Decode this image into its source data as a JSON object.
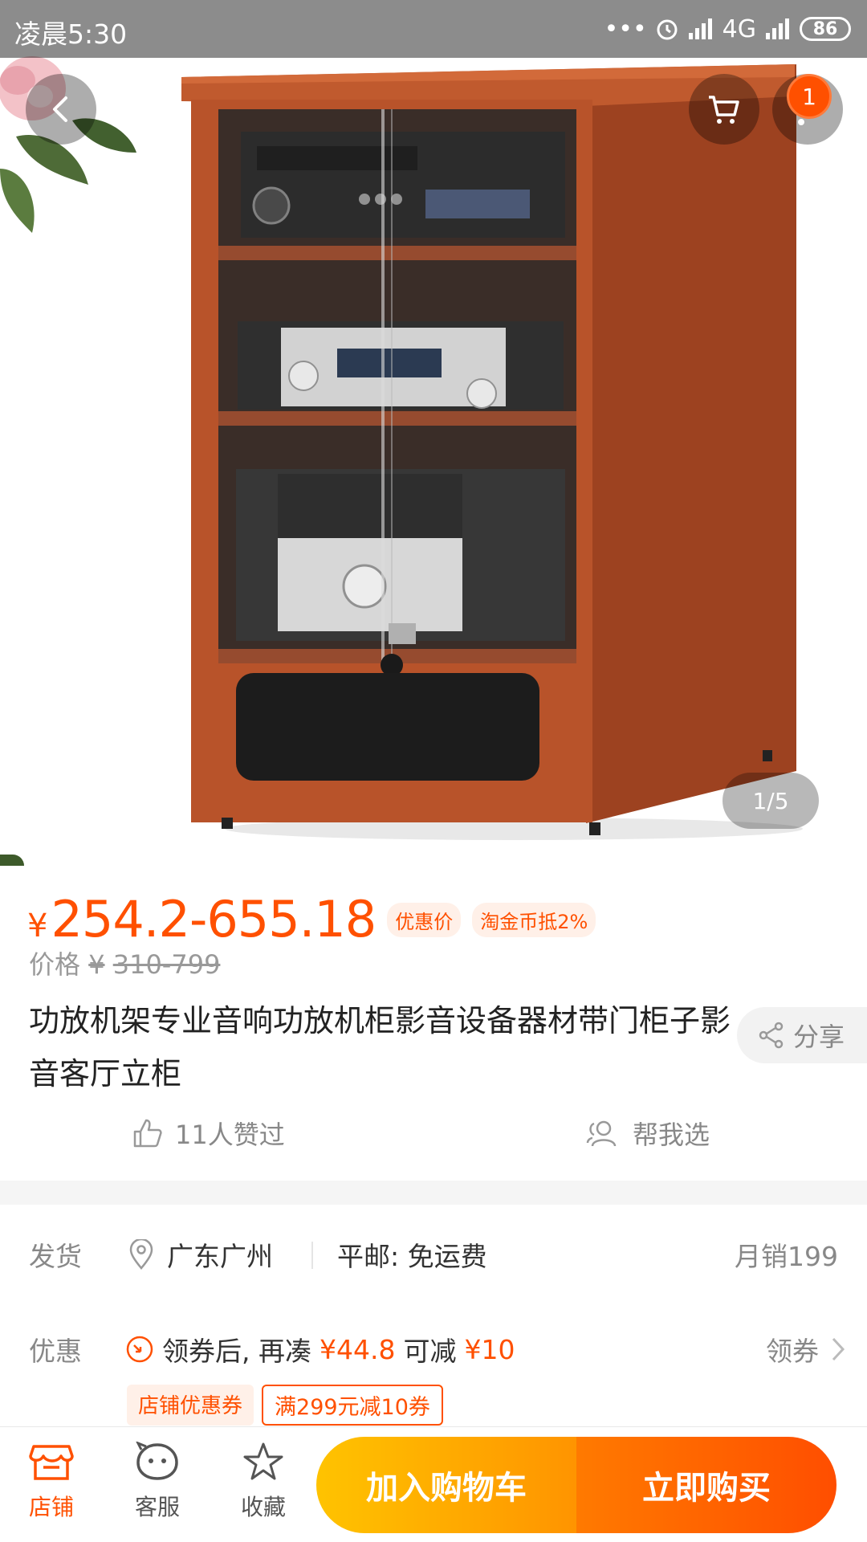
{
  "status_bar": {
    "time": "凌晨5:30",
    "dots": "•••",
    "network": "4G",
    "battery": "86"
  },
  "gallery": {
    "pager": "1/5",
    "cart_badge": "1",
    "icons": [
      "back-icon",
      "cart-icon",
      "more-icon"
    ]
  },
  "product": {
    "currency": "¥",
    "price_range": "254.2-655.18",
    "tag_discount": "优惠价",
    "tag_coin": "淘金币抵2%",
    "orig_label": "价格",
    "orig_currency": "¥",
    "orig_range": "310-799",
    "title": "功放机架专业音响功放机柜影音设备器材带门柜子影音客厅立柜",
    "share": "分享",
    "likes": "11人赞过",
    "help_choose": "帮我选"
  },
  "shipping": {
    "label": "发货",
    "location": "广东广州",
    "fee": "平邮: 免运费",
    "monthly_sales": "月销199"
  },
  "promo": {
    "label": "优惠",
    "text_before": "领券后, 再凑",
    "amount_need": "¥44.8",
    "text_mid": "可减",
    "amount_off": "¥10",
    "coupon_link": "领券",
    "tag_shop": "店铺优惠券",
    "tag_offer": "满299元减10券"
  },
  "bottom_bar": {
    "shop": "店铺",
    "service": "客服",
    "favorite": "收藏",
    "add_to_cart": "加入购物车",
    "buy_now": "立即购买"
  },
  "colors": {
    "accent": "#ff5000",
    "cart_gradient": [
      "#ffc300",
      "#ff9400"
    ],
    "buy_gradient": [
      "#ff7a00",
      "#ff4e00"
    ],
    "wood": "#b8532a"
  }
}
